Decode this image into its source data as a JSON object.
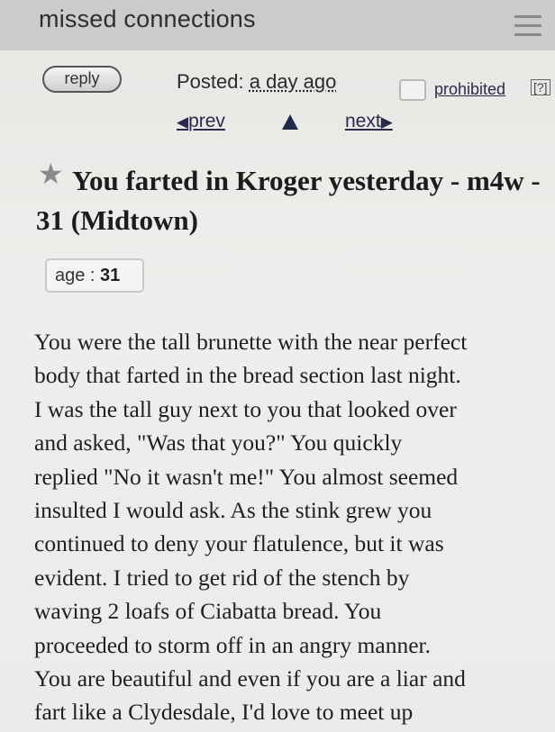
{
  "header": {
    "title": "missed connections",
    "menu_icon": "hamburger-menu-icon"
  },
  "toolbar": {
    "reply_label": "reply",
    "posted_label": "Posted:",
    "posted_when": "a day ago",
    "prohibited_label": "prohibited",
    "help_label": "[?]"
  },
  "nav": {
    "prev_label": "prev",
    "next_label": "next",
    "up_icon": "up-arrow-icon",
    "prev_icon": "left-arrow-icon",
    "next_icon": "right-arrow-icon"
  },
  "posting": {
    "title": "You farted in Kroger yesterday - m4w - 31 (Midtown)",
    "star_icon": "star-icon",
    "age_label": "age :",
    "age_value": "31",
    "body_lines": [
      "You were the tall brunette with the near perfect",
      "body that farted in the bread section last night.",
      "I was the tall guy next to you that looked over",
      "and asked, \"Was that you?\" You quickly",
      "replied \"No it wasn't me!\" You almost seemed",
      "insulted I would ask. As the stink grew you",
      "continued to deny your flatulence, but it was",
      "evident. I tried to get rid of the stench by",
      "waving 2 loafs of Ciabatta bread. You",
      "proceeded to storm off in an angry manner.",
      "You are beautiful and even if you are a liar and",
      "fart like a Clydesdale, I'd love to meet up"
    ]
  },
  "colors": {
    "header_bg": "#cbcbc9",
    "page_bg": "#eeeeec",
    "link": "#2a2a4a"
  }
}
